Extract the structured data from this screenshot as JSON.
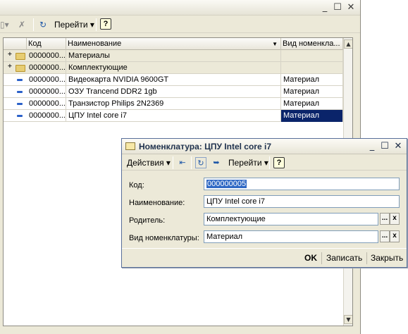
{
  "main_window": {
    "title_controls": {
      "minimize": "_",
      "maximize": "☐",
      "close": "✕"
    },
    "toolbar": {
      "goto_label": "Перейти",
      "help_label": "?"
    },
    "grid": {
      "columns": [
        "Код",
        "Наименование",
        "Вид номенкла..."
      ],
      "rows": [
        {
          "type": "group",
          "code": "0000000...",
          "name": "Материалы",
          "kind": ""
        },
        {
          "type": "group",
          "code": "0000000...",
          "name": "Комплектующие",
          "kind": ""
        },
        {
          "type": "item",
          "code": "0000000...",
          "name": "Видеокарта NVIDIA 9600GT",
          "kind": "Материал"
        },
        {
          "type": "item",
          "code": "0000000...",
          "name": "ОЗУ Trancend DDR2 1gb",
          "kind": "Материал"
        },
        {
          "type": "item",
          "code": "0000000...",
          "name": "Транзистор Philips 2N2369",
          "kind": "Материал"
        },
        {
          "type": "item",
          "code": "0000000...",
          "name": "ЦПУ Intel core i7",
          "kind": "Материал"
        }
      ]
    }
  },
  "dialog": {
    "title": "Номенклатура: ЦПУ Intel core i7",
    "controls": {
      "minimize": "_",
      "maximize": "☐",
      "close": "✕"
    },
    "toolbar": {
      "actions_label": "Действия",
      "goto_label": "Перейти",
      "help_label": "?"
    },
    "fields": {
      "code": {
        "label": "Код:",
        "value": "000000005"
      },
      "name": {
        "label": "Наименование:",
        "value": "ЦПУ Intel core i7"
      },
      "parent": {
        "label": "Родитель:",
        "value": "Комплектующие"
      },
      "kind": {
        "label": "Вид номенклатуры:",
        "value": "Материал"
      }
    },
    "buttons": {
      "ok": "OK",
      "save": "Записать",
      "close": "Закрыть"
    },
    "mini_buttons": {
      "select": "...",
      "clear": "x"
    }
  },
  "colors": {
    "selection": "#0a246a",
    "accent": "#316ac5"
  }
}
